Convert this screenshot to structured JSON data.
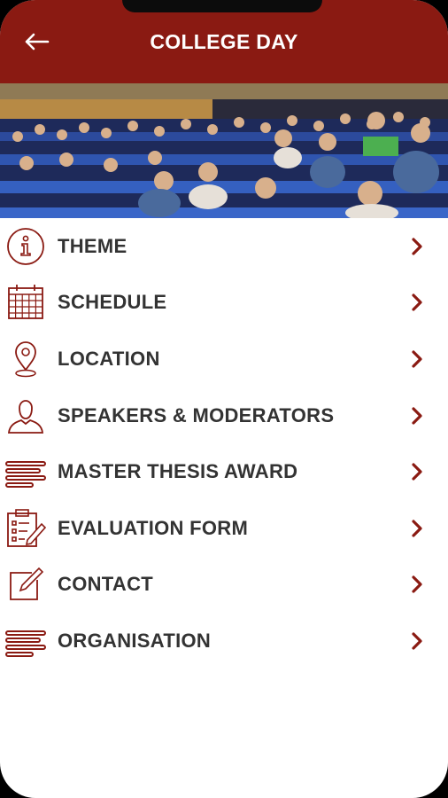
{
  "header": {
    "title": "COLLEGE DAY",
    "back_icon": "arrow-left-icon"
  },
  "colors": {
    "brand": "#8a1a12",
    "text": "#333333",
    "background": "#ffffff"
  },
  "hero": {
    "description_icon": "audience-photo"
  },
  "menu": {
    "items": [
      {
        "label": "THEME",
        "icon": "info-icon"
      },
      {
        "label": "SCHEDULE",
        "icon": "calendar-icon"
      },
      {
        "label": "LOCATION",
        "icon": "map-pin-icon"
      },
      {
        "label": "SPEAKERS & MODERATORS",
        "icon": "person-icon"
      },
      {
        "label": "MASTER THESIS AWARD",
        "icon": "lines-icon"
      },
      {
        "label": "EVALUATION FORM",
        "icon": "clipboard-icon"
      },
      {
        "label": "CONTACT",
        "icon": "edit-icon"
      },
      {
        "label": "ORGANISATION",
        "icon": "lines-icon"
      }
    ]
  }
}
